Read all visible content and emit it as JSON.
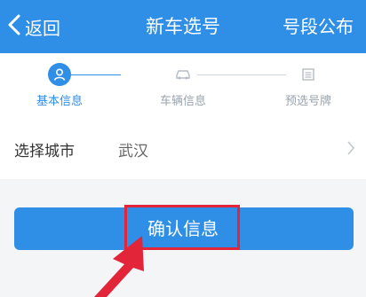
{
  "navbar": {
    "back_label": "返回",
    "title": "新车选号",
    "right_label": "号段公布",
    "back_icon": "chevron-left-icon"
  },
  "steps": [
    {
      "label": "基本信息",
      "icon": "user-icon",
      "state": "active"
    },
    {
      "label": "车辆信息",
      "icon": "car-icon",
      "state": "inactive"
    },
    {
      "label": "预选号牌",
      "icon": "license-plate-icon",
      "state": "inactive"
    }
  ],
  "city": {
    "label": "选择城市",
    "value": "武汉",
    "chevron_icon": "chevron-right-icon"
  },
  "confirm": {
    "label": "确认信息"
  },
  "colors": {
    "brand": "#2f8ee6",
    "highlight": "#e3253a",
    "inactive": "#9aa3ae",
    "background": "#f4f5f7"
  }
}
